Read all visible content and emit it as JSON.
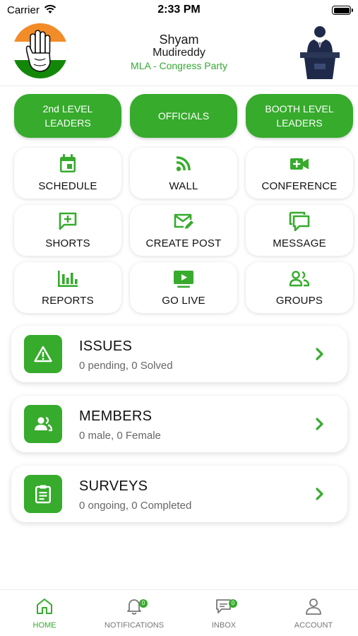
{
  "status_bar": {
    "carrier": "Carrier",
    "time": "2:33 PM"
  },
  "profile": {
    "first_name": "Shyam",
    "last_name": "Mudireddy",
    "role": "MLA - Congress Party"
  },
  "level_buttons": [
    {
      "label": "2nd LEVEL LEADERS"
    },
    {
      "label": "OFFICIALS"
    },
    {
      "label": "BOOTH LEVEL LEADERS"
    }
  ],
  "tiles": [
    {
      "label": "SCHEDULE",
      "icon": "calendar-icon"
    },
    {
      "label": "WALL",
      "icon": "rss-icon"
    },
    {
      "label": "CONFERENCE",
      "icon": "video-add-icon"
    },
    {
      "label": "SHORTS",
      "icon": "chat-add-icon"
    },
    {
      "label": "CREATE POST",
      "icon": "mail-edit-icon"
    },
    {
      "label": "MESSAGE",
      "icon": "messages-icon"
    },
    {
      "label": "REPORTS",
      "icon": "bar-chart-icon"
    },
    {
      "label": "GO LIVE",
      "icon": "play-screen-icon"
    },
    {
      "label": "GROUPS",
      "icon": "group-icon"
    }
  ],
  "cards": [
    {
      "title": "ISSUES",
      "subtitle": "0 pending, 0 Solved",
      "icon": "warning-icon"
    },
    {
      "title": "MEMBERS",
      "subtitle": "0 male, 0 Female",
      "icon": "members-icon"
    },
    {
      "title": "SURVEYS",
      "subtitle": "0 ongoing, 0 Completed",
      "icon": "clipboard-icon"
    }
  ],
  "bottom_nav": [
    {
      "label": "HOME",
      "icon": "home-icon",
      "active": true
    },
    {
      "label": "NOTIFICATIONS",
      "icon": "bell-icon",
      "badge": "0"
    },
    {
      "label": "INBOX",
      "icon": "chat-bubble-icon",
      "badge": "0"
    },
    {
      "label": "ACCOUNT",
      "icon": "person-icon"
    }
  ],
  "colors": {
    "accent": "#36ab2c",
    "flag_saffron": "#f28c28",
    "flag_green": "#138808",
    "text_muted": "#666666"
  }
}
